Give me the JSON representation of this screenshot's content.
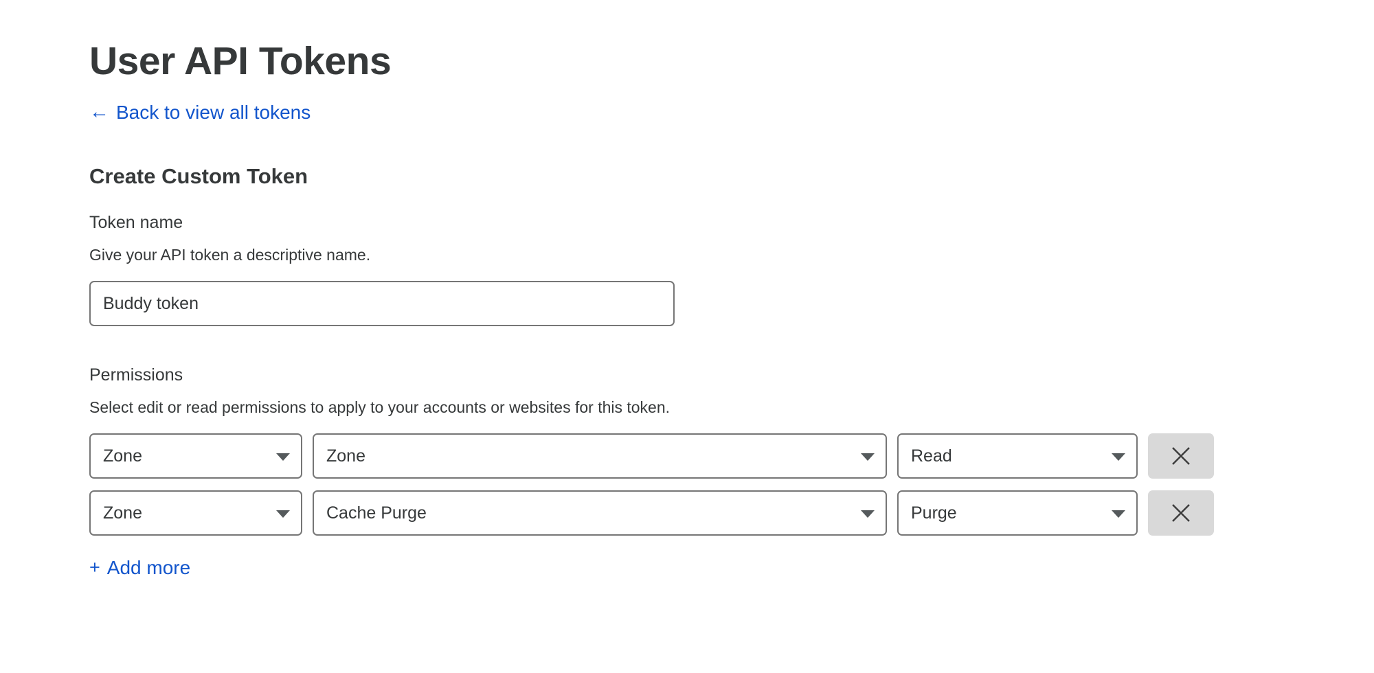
{
  "page": {
    "title": "User API Tokens"
  },
  "back_link": {
    "icon": "arrow-left-icon",
    "arrow_glyph": "←",
    "label": "Back to view all tokens"
  },
  "form": {
    "section_title": "Create Custom Token",
    "token_name": {
      "label": "Token name",
      "help": "Give your API token a descriptive name.",
      "value": "Buddy token",
      "placeholder": "Token name"
    },
    "permissions": {
      "label": "Permissions",
      "help": "Select edit or read permissions to apply to your accounts or websites for this token.",
      "rows": [
        {
          "scope": "Zone",
          "kind": "Zone",
          "access": "Read",
          "remove_icon": "close-icon"
        },
        {
          "scope": "Zone",
          "kind": "Cache Purge",
          "access": "Purge",
          "remove_icon": "close-icon"
        }
      ],
      "add_more": {
        "icon": "plus-icon",
        "plus_glyph": "+",
        "label": "Add more"
      }
    }
  },
  "colors": {
    "link": "#1255cc",
    "text": "#36393a",
    "border": "#767676",
    "button_bg": "#d9d9d9",
    "background": "#ffffff"
  }
}
